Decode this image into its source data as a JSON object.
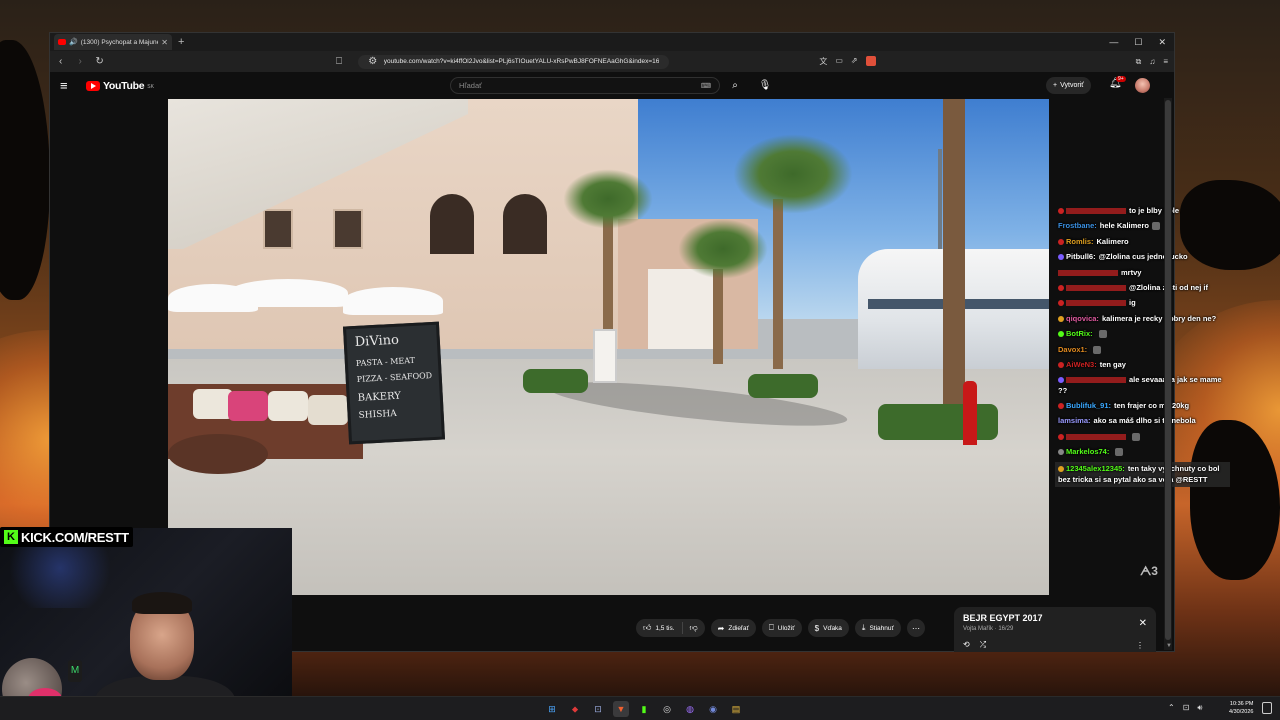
{
  "browser": {
    "tab_title": "(1300) Psychopat a Majuner s",
    "url": "youtube.com/watch?v=ki4ffOl2Jvo&list=PLj6sTIOuetYALU-xRsPwBJ8FOFNEAaGhG&index=16"
  },
  "youtube": {
    "logo_text": "YouTube",
    "region": "SK",
    "search_placeholder": "Hľadať",
    "create_label": "Vytvoriť",
    "notification_badge": "9+"
  },
  "chat": [
    {
      "user": "",
      "user_color": "#cc2222",
      "badge_color": "#cc2222",
      "msg": "to je blby vole",
      "emote": false
    },
    {
      "user": "Frostbane:",
      "user_color": "#3a8fe0",
      "badge_color": "",
      "msg": "hele Kalimero",
      "emote": true
    },
    {
      "user": "Romlis:",
      "user_color": "#e0a020",
      "badge_color": "#cc2222",
      "msg": "Kalimero",
      "emote": false
    },
    {
      "user": "Pitbull6:",
      "user_color": "#ffffff",
      "badge_color": "#7b5cff",
      "msg": "@Zlolina cus jednorucko",
      "emote": false
    },
    {
      "user": "",
      "user_color": "#cc2222",
      "badge_color": "",
      "msg": "mrtvy",
      "emote": false
    },
    {
      "user": "",
      "user_color": "#cc2222",
      "badge_color": "#cc2222",
      "msg": "@Zlolina zisti od nej if",
      "emote": false
    },
    {
      "user": "",
      "user_color": "#cc2222",
      "badge_color": "#cc2222",
      "msg": "ig",
      "emote": false
    },
    {
      "user": "qiqovica:",
      "user_color": "#e05aa0",
      "badge_color": "#e0a020",
      "msg": "kalimera je recky dobry den ne?",
      "emote": false
    },
    {
      "user": "BotRix:",
      "user_color": "#53fc18",
      "badge_color": "#53fc18",
      "msg": "",
      "emote": true
    },
    {
      "user": "Davox1:",
      "user_color": "#e08a20",
      "badge_color": "",
      "msg": "",
      "emote": true
    },
    {
      "user": "AiWeN3:",
      "user_color": "#cc2222",
      "badge_color": "#cc2222",
      "msg": "ten gay",
      "emote": false
    },
    {
      "user": "",
      "user_color": "#cc2222",
      "badge_color": "#7b5cff",
      "msg": "ale sevaaaaa jak se mame ??",
      "emote": false
    },
    {
      "user": "Bublifuk_91:",
      "user_color": "#3aa8ff",
      "badge_color": "#cc2222",
      "msg": "ten frajer co ma 20kg",
      "emote": false
    },
    {
      "user": "lamsima:",
      "user_color": "#9a9aff",
      "badge_color": "",
      "msg": "ako sa máš dlho si tu nebola",
      "emote": false
    },
    {
      "user": "",
      "user_color": "#cc2222",
      "badge_color": "#cc2222",
      "msg": "",
      "emote": true
    },
    {
      "user": "Markelos74:",
      "user_color": "#53fc18",
      "badge_color": "#888888",
      "msg": "",
      "emote": true
    },
    {
      "user": "12345alex12345:",
      "user_color": "#53fc18",
      "badge_color": "#e0a020",
      "msg": "ten taky vyschnuty co bol bez tricka si sa pytal ako sa vola @RESTT",
      "emote": false,
      "highlight": true
    }
  ],
  "video": {
    "board_lines": [
      "DiVino",
      "PASTA - MEAT",
      "PIZZA - SEAFOOD",
      "BAKERY",
      "SHISHA"
    ]
  },
  "actions": {
    "likes": "1,5 tis.",
    "share": "Zdieľať",
    "save": "Uložiť",
    "thanks": "Vďaka",
    "download": "Stiahnuť"
  },
  "playlist": {
    "title": "BEJR EGYPT 2017",
    "subtitle": "Vojta Mařík · 16/29"
  },
  "kick": {
    "banner": "KICK.COM/RESTT"
  },
  "taskbar": {
    "time": "10:36 PM",
    "date": "4/30/2026"
  },
  "colors": {
    "youtube_red": "#ff0000",
    "kick_green": "#53fc18"
  }
}
